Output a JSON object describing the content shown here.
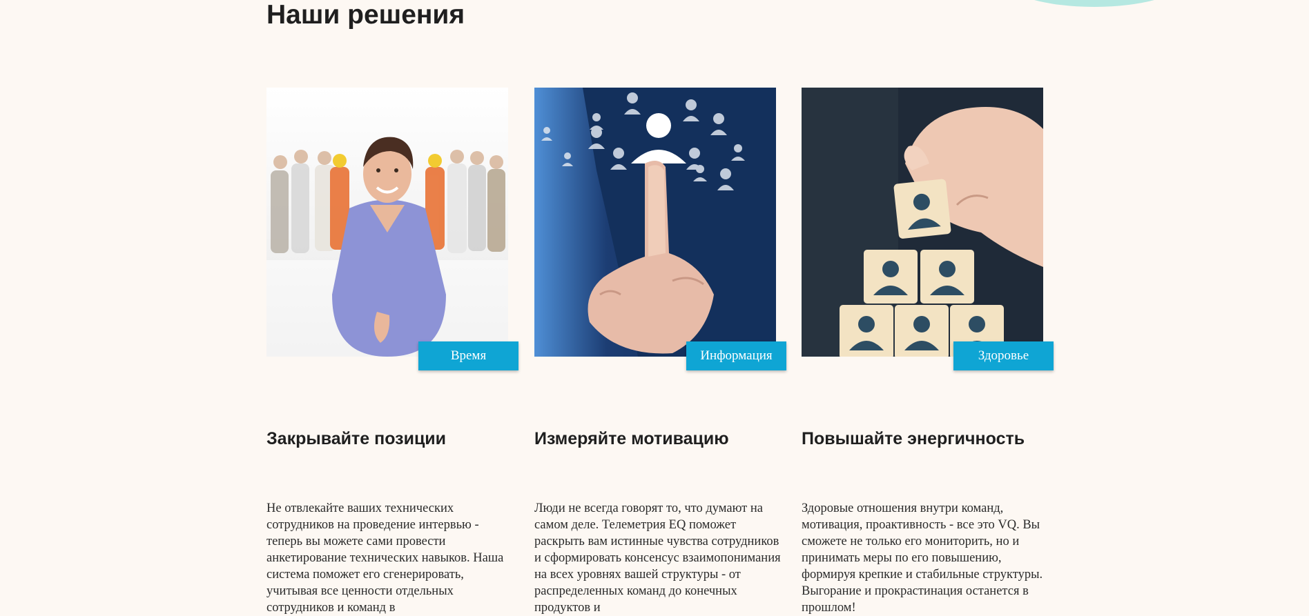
{
  "section": {
    "title": "Наши решения"
  },
  "cards": [
    {
      "badge": "Время",
      "heading": "Закрывайте позиции",
      "text": "Не отвлекайте ваших технических сотрудников на проведение интервью - теперь вы можете сами провести анкетирование технических навыков. Наша система поможет его сгенерировать, учитывая все ценности отдельных сотрудников и команд в",
      "image_icon": "handshake-woman-photo"
    },
    {
      "badge": "Информация",
      "heading": "Измеряйте мотивацию",
      "text": "Люди не всегда говорят то, что думают на самом деле. Телеметрия EQ поможет раскрыть вам истинные чувства сотрудников и сформировать консенсус взаимопонимания на всех уровнях вашей структуры - от распределенных команд до конечных продуктов и",
      "image_icon": "finger-touch-people-photo"
    },
    {
      "badge": "Здоровье",
      "heading": "Повышайте энергичность",
      "text": "Здоровые отношения внутри команд, мотивация, проактивность - все это VQ. Вы сможете не только его мониторить, но и принимать меры по его повышению, формируя крепкие и стабильные структуры. Выгорание и прокрастинация останется в прошлом!",
      "image_icon": "wooden-blocks-people-photo"
    }
  ],
  "colors": {
    "background": "#fdf8f3",
    "accent": "#0fa5d4",
    "decoration": "#b5e8e1"
  }
}
